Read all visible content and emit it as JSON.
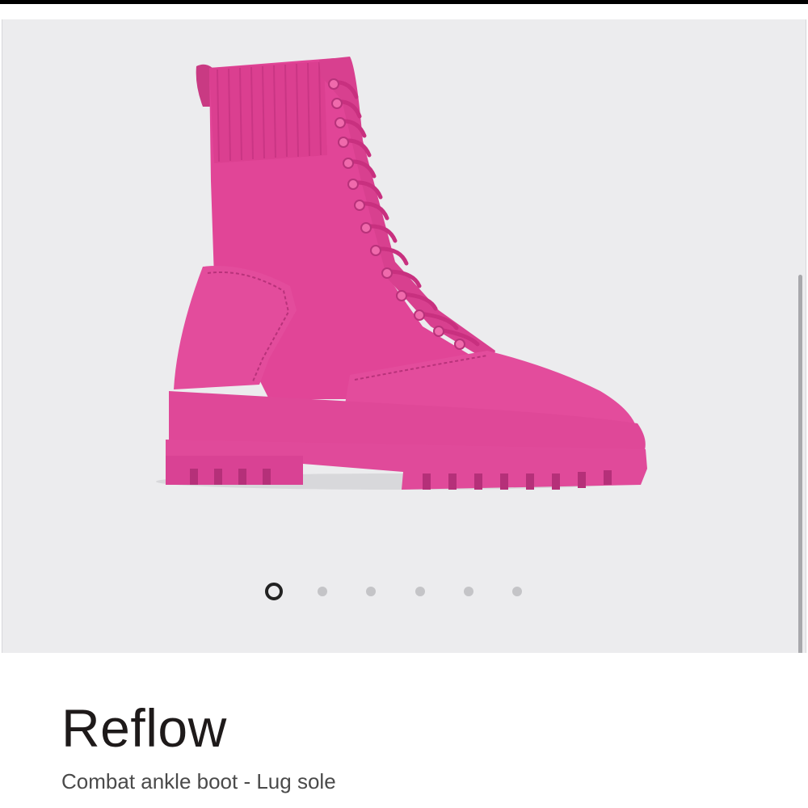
{
  "product": {
    "name": "Reflow",
    "description": "Combat ankle boot - Lug sole",
    "image_subject": "pink-combat-ankle-boot",
    "color": "#e6449a"
  },
  "gallery": {
    "background": "#ececee",
    "slides_total": 6,
    "active_slide": 1
  }
}
